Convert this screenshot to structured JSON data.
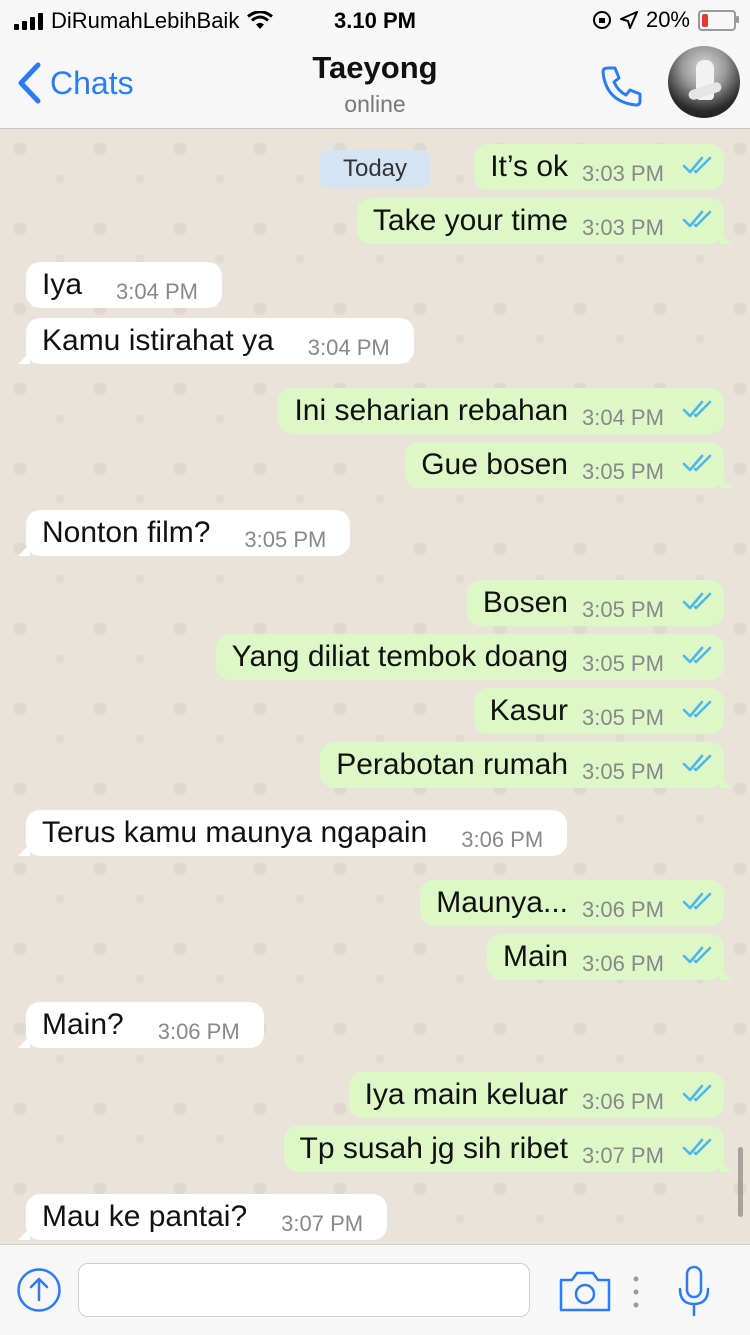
{
  "status_bar": {
    "carrier": "DiRumahLebihBaik",
    "time": "3.10 PM",
    "battery": "20%",
    "battery_level": 0.2
  },
  "header": {
    "back_label": "Chats",
    "contact_name": "Taeyong",
    "contact_status": "online"
  },
  "date_badge": "Today",
  "messages": [
    {
      "dir": "out",
      "text": "It’s ok",
      "time": "3:03 PM"
    },
    {
      "dir": "out",
      "text": "Take your time",
      "time": "3:03 PM"
    },
    {
      "dir": "in",
      "text": "Iya",
      "time": "3:04 PM"
    },
    {
      "dir": "in",
      "text": "Kamu istirahat ya",
      "time": "3:04 PM"
    },
    {
      "dir": "out",
      "text": "Ini seharian rebahan",
      "time": "3:04 PM"
    },
    {
      "dir": "out",
      "text": "Gue bosen",
      "time": "3:05 PM"
    },
    {
      "dir": "in",
      "text": "Nonton film?",
      "time": "3:05 PM"
    },
    {
      "dir": "out",
      "text": "Bosen",
      "time": "3:05 PM"
    },
    {
      "dir": "out",
      "text": "Yang diliat tembok doang",
      "time": "3:05 PM"
    },
    {
      "dir": "out",
      "text": "Kasur",
      "time": "3:05 PM"
    },
    {
      "dir": "out",
      "text": "Perabotan rumah",
      "time": "3:05 PM"
    },
    {
      "dir": "in",
      "text": "Terus kamu maunya ngapain",
      "time": "3:06 PM"
    },
    {
      "dir": "out",
      "text": "Maunya...",
      "time": "3:06 PM"
    },
    {
      "dir": "out",
      "text": "Main",
      "time": "3:06 PM"
    },
    {
      "dir": "in",
      "text": "Main?",
      "time": "3:06 PM"
    },
    {
      "dir": "out",
      "text": "Iya main keluar",
      "time": "3:06 PM"
    },
    {
      "dir": "out",
      "text": "Tp susah jg sih ribet",
      "time": "3:07 PM"
    },
    {
      "dir": "in",
      "text": "Mau ke pantai?",
      "time": "3:07 PM"
    }
  ],
  "input": {
    "value": "",
    "placeholder": ""
  },
  "icons": {
    "back": "chevron-left-icon",
    "call": "phone-icon",
    "upload": "upload-icon",
    "camera": "camera-icon",
    "more": "more-dots-icon",
    "mic": "microphone-icon",
    "read": "double-check-icon"
  },
  "colors": {
    "accent": "#2b7cf6",
    "outgoing_bubble": "#dcf8c6",
    "incoming_bubble": "#ffffff",
    "ticks": "#4fb6ec",
    "battery_low": "#e53a32"
  }
}
